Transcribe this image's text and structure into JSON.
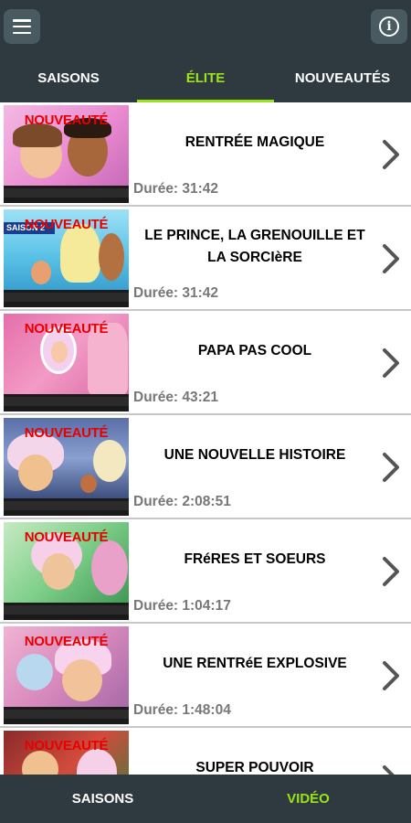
{
  "header": {
    "menu_icon": "hamburger-menu-icon",
    "info_icon": "info-icon"
  },
  "tabs": [
    {
      "label": "SAISONS",
      "active": false
    },
    {
      "label": "ÉLITE",
      "active": true
    },
    {
      "label": "NOUVEAUTÉS",
      "active": false
    }
  ],
  "badge_label": "NOUVEAUTÉ",
  "episodes": [
    {
      "title": "RENTRÉE MAGIQUE",
      "duration": "Durée: 31:42"
    },
    {
      "title": "LE PRINCE, LA GRENOUILLE ET LA SORCIèRE",
      "duration": "Durée: 31:42"
    },
    {
      "title": "PAPA PAS COOL",
      "duration": "Durée: 43:21"
    },
    {
      "title": "UNE NOUVELLE HISTOIRE",
      "duration": "Durée: 2:08:51"
    },
    {
      "title": "FRéRES ET SOEURS",
      "duration": "Durée: 1:04:17"
    },
    {
      "title": "UNE RENTRéE EXPLOSIVE",
      "duration": "Durée: 1:48:04"
    },
    {
      "title": "SUPER POUVOIR",
      "duration": ""
    }
  ],
  "thumbnail_overlay": "SAISON 2",
  "bottom_nav": [
    {
      "label": "SAISONS",
      "active": false
    },
    {
      "label": "VIDÉO",
      "active": true
    }
  ],
  "colors": {
    "bar_bg": "#2e3a3f",
    "accent": "#9be31a",
    "badge": "#e60000",
    "duration": "#777777"
  }
}
